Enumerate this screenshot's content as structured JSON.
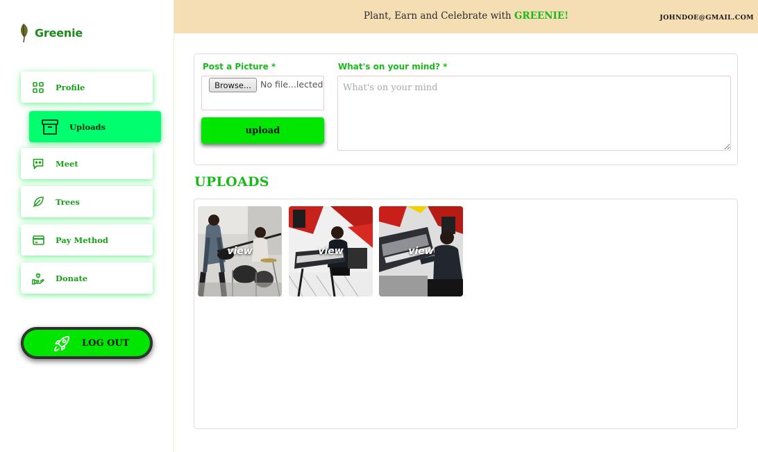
{
  "brand": {
    "name": "Greenie"
  },
  "nav": {
    "items": [
      {
        "label": "Profile",
        "icon": "grid-icon"
      },
      {
        "label": "Uploads",
        "icon": "archive-icon",
        "active": true
      },
      {
        "label": "Meet",
        "icon": "chat-icon"
      },
      {
        "label": "Trees",
        "icon": "leaf-icon"
      },
      {
        "label": "Pay Method",
        "icon": "credit-card-icon"
      },
      {
        "label": "Donate",
        "icon": "donate-hand-icon"
      }
    ],
    "logout_label": "LOG OUT",
    "logout_icon": "rocket-icon"
  },
  "header": {
    "message_prefix": "Plant, Earn and Celebrate with ",
    "message_accent": "GREENIE!",
    "email": "JOHNDOE@GMAIL.COM"
  },
  "post": {
    "picture_label": "Post a Picture *",
    "browse_label": "Browse...",
    "file_status": "No file...lected",
    "upload_label": "upload",
    "mind_label": "What's on your mind? *",
    "mind_placeholder": "What's on your mind"
  },
  "uploads": {
    "heading": "UPLOADS",
    "items": [
      {
        "view_label": "view"
      },
      {
        "view_label": "view"
      },
      {
        "view_label": "view"
      }
    ]
  },
  "colors": {
    "accent_green": "#19b919",
    "active_nav": "#00ff6e",
    "button_green": "#00e600",
    "header_bg": "#f5deb3"
  }
}
